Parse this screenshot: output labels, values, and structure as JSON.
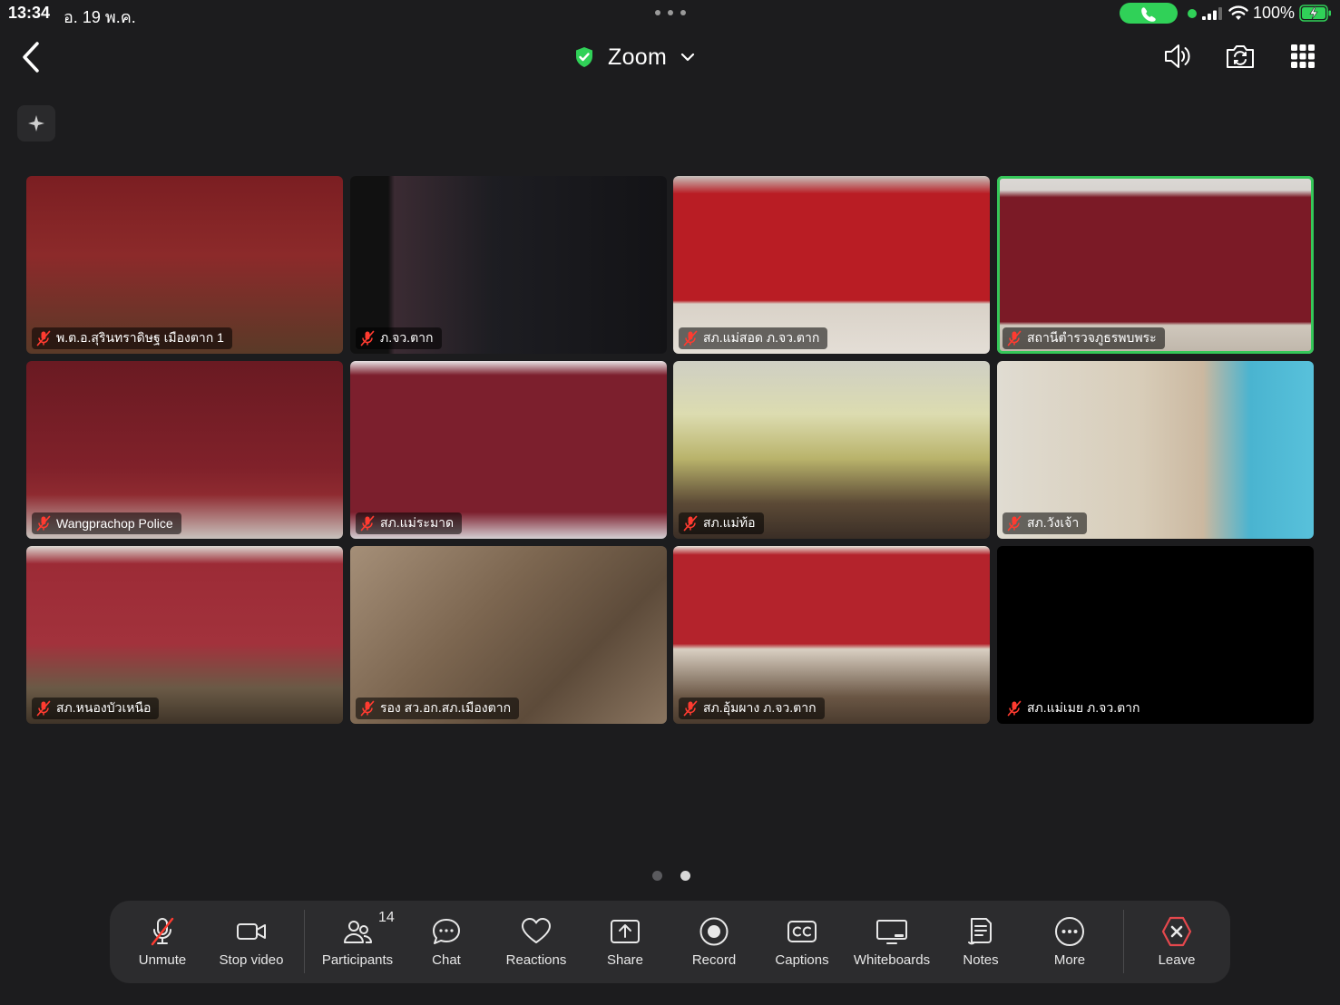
{
  "status_bar": {
    "time": "13:34",
    "date": "อ. 19 พ.ค.",
    "battery": "100%"
  },
  "header": {
    "title": "Zoom"
  },
  "participants": [
    {
      "name": "พ.ต.อ.สุรินทราดิษฐ เมืองตาก 1",
      "muted": true,
      "active_speaker": false
    },
    {
      "name": "ภ.จว.ตาก",
      "muted": true,
      "active_speaker": false
    },
    {
      "name": "สภ.แม่สอด ภ.จว.ตาก",
      "muted": true,
      "active_speaker": false
    },
    {
      "name": "สถานีตำรวจภูธรพบพระ",
      "muted": true,
      "active_speaker": true
    },
    {
      "name": "Wangprachop Police",
      "muted": true,
      "active_speaker": false
    },
    {
      "name": "สภ.แม่ระมาด",
      "muted": true,
      "active_speaker": false
    },
    {
      "name": "สภ.แม่ท้อ",
      "muted": true,
      "active_speaker": false
    },
    {
      "name": "สภ.วังเจ้า",
      "muted": true,
      "active_speaker": false
    },
    {
      "name": "สภ.หนองบัวเหนือ",
      "muted": true,
      "active_speaker": false
    },
    {
      "name": "รอง สว.อก.สภ.เมืองตาก",
      "muted": true,
      "active_speaker": false
    },
    {
      "name": "สภ.อุ้มผาง ภ.จว.ตาก",
      "muted": true,
      "active_speaker": false
    },
    {
      "name": "สภ.แม่เมย ภ.จว.ตาก",
      "muted": true,
      "active_speaker": false
    }
  ],
  "pagination": {
    "current": 2,
    "total": 2
  },
  "toolbar": {
    "unmute": "Unmute",
    "stop_video": "Stop video",
    "participants": "Participants",
    "participants_count": "14",
    "chat": "Chat",
    "reactions": "Reactions",
    "share": "Share",
    "record": "Record",
    "captions": "Captions",
    "whiteboards": "Whiteboards",
    "notes": "Notes",
    "more": "More",
    "leave": "Leave"
  },
  "colors": {
    "background": "#1c1c1e",
    "toolbar": "#2c2c2e",
    "active_speaker_border": "#35c759",
    "muted_icon": "#ff3b30",
    "leave": "#e5484d",
    "security_shield": "#30d158"
  }
}
